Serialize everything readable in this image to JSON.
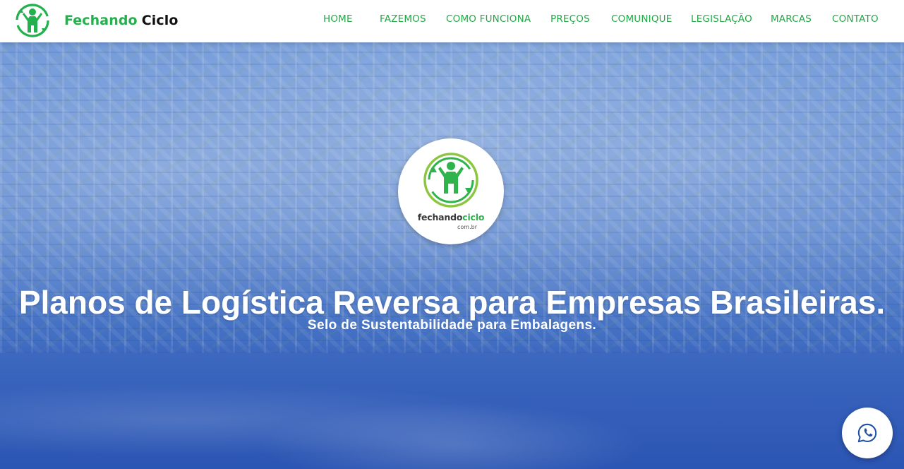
{
  "brand": {
    "name_part1": "Fechando",
    "name_part2": "Ciclo",
    "logo_icon": "recycle-person-icon",
    "color": "#22b14c"
  },
  "nav": {
    "items": [
      {
        "label": "HOME"
      },
      {
        "label": "FAZEMOS"
      },
      {
        "label": "COMO FUNCIONA"
      },
      {
        "label": "PREÇOS"
      },
      {
        "label": "COMUNIQUE"
      },
      {
        "label": "LEGISLAÇÃO"
      },
      {
        "label": "MARCAS"
      },
      {
        "label": "CONTATO"
      }
    ],
    "color": "#22a846"
  },
  "hero": {
    "logo_badge": {
      "text_part1": "fechando",
      "text_part2": "ciclo",
      "domain": "com.br"
    },
    "title": "Planos de Logística Reversa para Empresas Brasileiras.",
    "subtitle": "Selo de Sustentabilidade para Embalagens.",
    "overlay_color": "#3f6cc1"
  },
  "floating": {
    "whatsapp_icon": "whatsapp-icon"
  }
}
